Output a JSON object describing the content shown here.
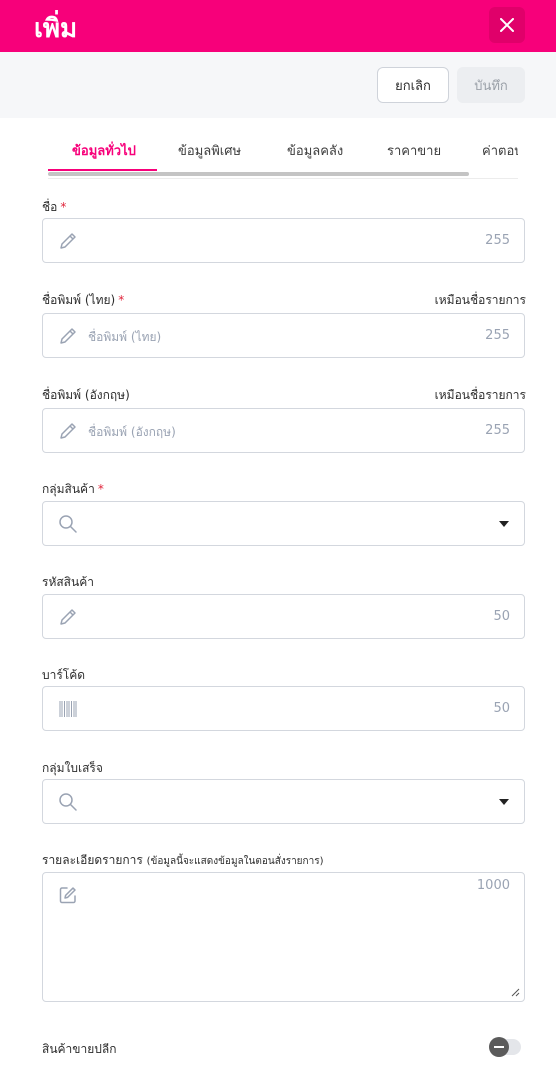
{
  "header": {
    "title": "เพิ่ม"
  },
  "actions": {
    "cancel_label": "ยกเลิก",
    "save_label": "บันทึก"
  },
  "tabs": [
    {
      "label": "ข้อมูลทั่วไป",
      "active": true
    },
    {
      "label": "ข้อมูลพิเศษ",
      "active": false
    },
    {
      "label": "ข้อมูลคลัง",
      "active": false
    },
    {
      "label": "ราคาขาย",
      "active": false
    },
    {
      "label": "ค่าตอบ",
      "active": false
    }
  ],
  "form": {
    "name": {
      "label": "ชื่อ",
      "required_mark": "*",
      "value": "",
      "counter": "255",
      "icon": "pencil-icon"
    },
    "print_name_th": {
      "label": "ชื่อพิมพ์ (ไทย)",
      "required_mark": "*",
      "same_as_link": "เหมือนชื่อรายการ",
      "placeholder": "ชื่อพิมพ์ (ไทย)",
      "counter": "255",
      "icon": "pencil-icon"
    },
    "print_name_en": {
      "label": "ชื่อพิมพ์ (อังกฤษ)",
      "same_as_link": "เหมือนชื่อรายการ",
      "placeholder": "ชื่อพิมพ์ (อังกฤษ)",
      "counter": "255",
      "icon": "pencil-icon"
    },
    "product_group": {
      "label": "กลุ่มสินค้า",
      "required_mark": "*",
      "value": "",
      "icon": "search-icon"
    },
    "product_code": {
      "label": "รหัสสินค้า",
      "value": "",
      "counter": "50",
      "icon": "pencil-icon"
    },
    "barcode": {
      "label": "บาร์โค้ด",
      "value": "",
      "counter": "50",
      "icon": "barcode-icon"
    },
    "receipt_group": {
      "label": "กลุ่มใบเสร็จ",
      "value": "",
      "icon": "search-icon"
    },
    "description": {
      "label": "รายละเอียดรายการ",
      "note": "(ข้อมูลนี้จะแสดงข้อมูลในตอนสั่งรายการ)",
      "value": "",
      "counter": "1000",
      "icon": "edit-icon"
    },
    "retail_product": {
      "label": "สินค้าขายปลีก",
      "enabled": false
    }
  },
  "colors": {
    "brand": "#f7007a",
    "required": "#e0243a",
    "border": "#d3d7de",
    "muted": "#9aa3b3"
  }
}
